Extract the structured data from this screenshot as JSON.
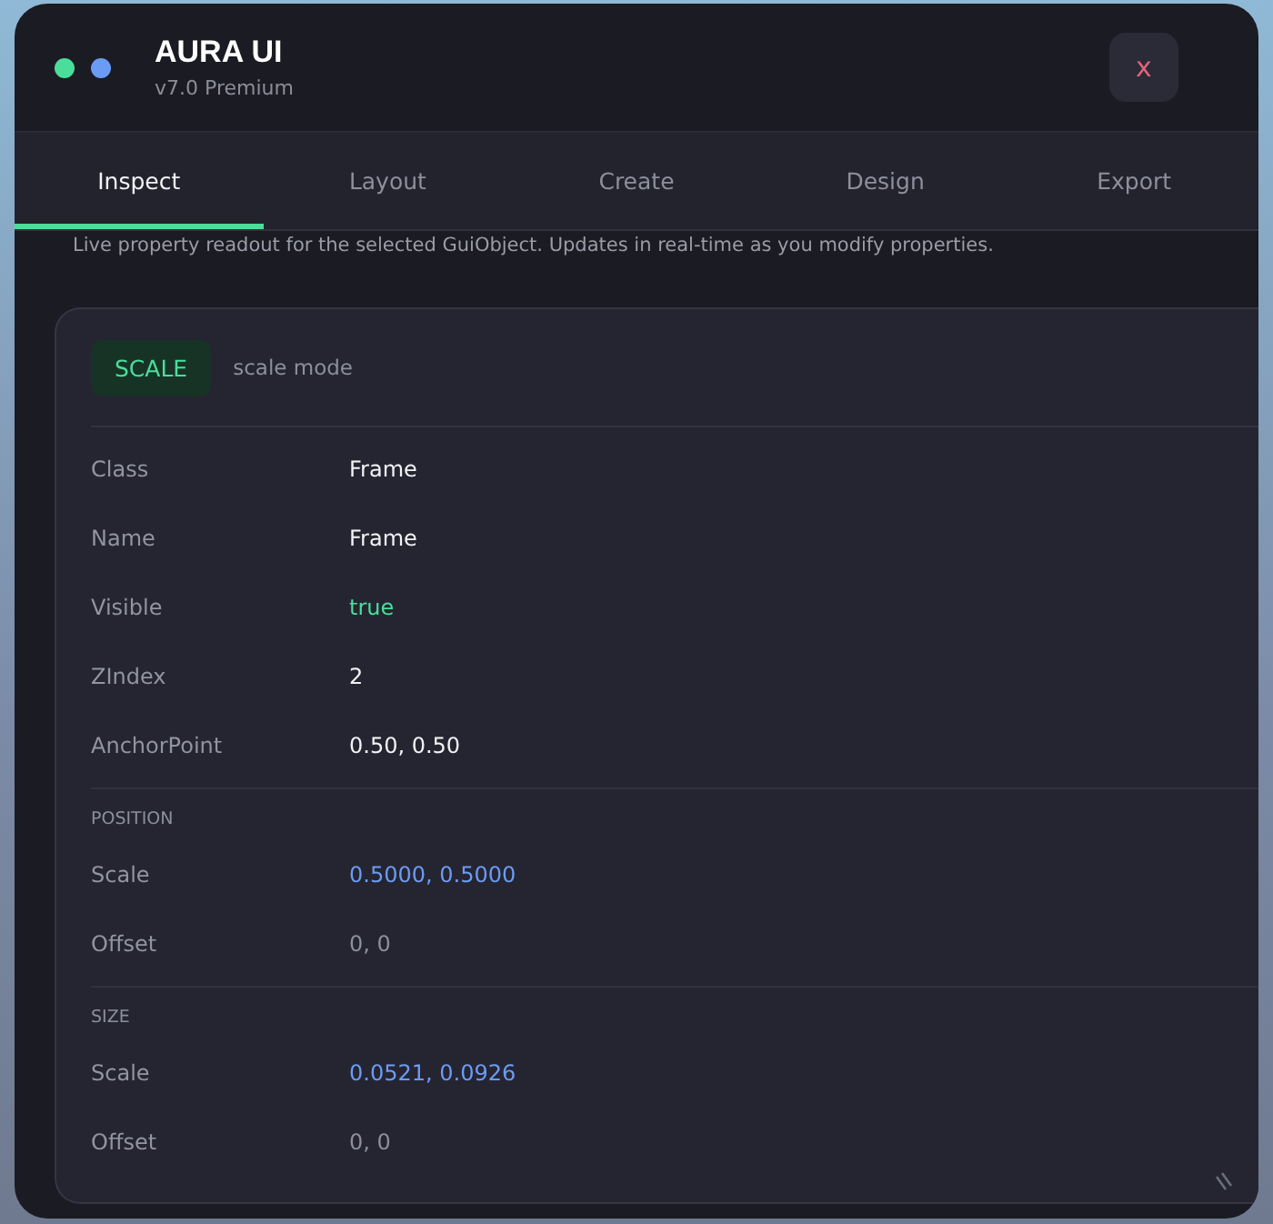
{
  "window": {
    "title": "AURA UI",
    "subtitle": "v7.0 Premium",
    "close_label": "x"
  },
  "dots": [
    {
      "color": "#4ade9a"
    },
    {
      "color": "#6b9cf5"
    }
  ],
  "tabs": [
    {
      "label": "Inspect",
      "selected": true
    },
    {
      "label": "Layout",
      "selected": false
    },
    {
      "label": "Create",
      "selected": false
    },
    {
      "label": "Design",
      "selected": false
    },
    {
      "label": "Export",
      "selected": false
    }
  ],
  "description": "Live property readout for the selected GuiObject. Updates in real-time as you modify properties.",
  "card": {
    "badge": "SCALE",
    "mode": "scale mode",
    "sections": [
      {
        "rows": [
          {
            "label": "Class",
            "value": "Frame",
            "kind": "plain"
          },
          {
            "label": "Name",
            "value": "Frame",
            "kind": "plain"
          },
          {
            "label": "Visible",
            "value": "true",
            "kind": "bool"
          },
          {
            "label": "ZIndex",
            "value": "2",
            "kind": "plain"
          },
          {
            "label": "AnchorPoint",
            "value": "0.50,  0.50",
            "kind": "plain"
          }
        ]
      },
      {
        "heading": "POSITION",
        "rows": [
          {
            "label": "Scale",
            "value": "0.5000,  0.5000",
            "kind": "scale"
          },
          {
            "label": "Offset",
            "value": "0,  0",
            "kind": "muted"
          }
        ]
      },
      {
        "heading": "SIZE",
        "rows": [
          {
            "label": "Scale",
            "value": "0.0521,  0.0926",
            "kind": "scale"
          },
          {
            "label": "Offset",
            "value": "0,  0",
            "kind": "muted"
          }
        ]
      }
    ]
  }
}
